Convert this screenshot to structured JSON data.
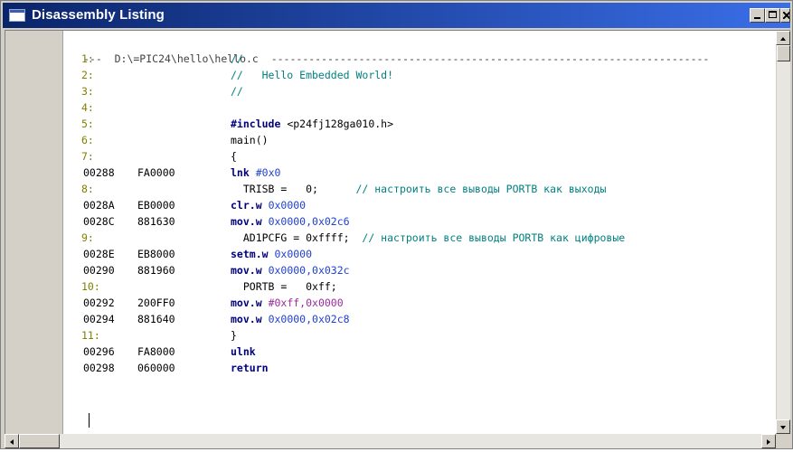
{
  "window": {
    "title": "Disassembly Listing",
    "buttons": {
      "minimize": "minimize",
      "maximize": "maximize",
      "close": "close"
    }
  },
  "listing": {
    "header": "---  D:\\=PIC24\\hello\\hello.c  ----------------------------------------------------------------------",
    "lines": [
      {
        "kind": "src",
        "num": "1:",
        "text": "//",
        "style": "cmt"
      },
      {
        "kind": "src",
        "num": "2:",
        "text": "//   Hello Embedded World!",
        "style": "cmt"
      },
      {
        "kind": "src",
        "num": "3:",
        "text": "//",
        "style": "cmt"
      },
      {
        "kind": "src",
        "num": "4:",
        "text": "",
        "style": "plain"
      },
      {
        "kind": "src",
        "num": "5:",
        "text_kw": "#include",
        "text_rest": " <p24fj128ga010.h>"
      },
      {
        "kind": "src",
        "num": "6:",
        "text": "main()",
        "style": "plain"
      },
      {
        "kind": "src",
        "num": "7:",
        "text": "{",
        "style": "plain"
      },
      {
        "kind": "asm",
        "addr": "00288",
        "hex": "FA0000",
        "mn": "lnk",
        "ops": "#0x0",
        "ops_style": "op"
      },
      {
        "kind": "src",
        "num": "8:",
        "text_code": "  TRISB =   0;",
        "text_cmt": "      // настроить все выводы PORTB как выходы"
      },
      {
        "kind": "asm",
        "addr": "0028A",
        "hex": "EB0000",
        "mn": "clr.w",
        "ops": "0x0000",
        "ops_style": "op"
      },
      {
        "kind": "asm",
        "addr": "0028C",
        "hex": "881630",
        "mn": "mov.w",
        "ops": "0x0000,0x02c6",
        "ops_style": "op"
      },
      {
        "kind": "src",
        "num": "9:",
        "text_code": "  AD1PCFG = 0xffff;",
        "text_cmt": "  // настроить все выводы PORTB как цифровые"
      },
      {
        "kind": "asm",
        "addr": "0028E",
        "hex": "EB8000",
        "mn": "setm.w",
        "ops": "0x0000",
        "ops_style": "op"
      },
      {
        "kind": "asm",
        "addr": "00290",
        "hex": "881960",
        "mn": "mov.w",
        "ops": "0x0000,0x032c",
        "ops_style": "op"
      },
      {
        "kind": "src",
        "num": "10:",
        "text_code": "  PORTB =   0xff;",
        "text_cmt": ""
      },
      {
        "kind": "asm",
        "addr": "00292",
        "hex": "200FF0",
        "mn": "mov.w",
        "ops": "#0xff,0x0000",
        "ops_style": "opm"
      },
      {
        "kind": "asm",
        "addr": "00294",
        "hex": "881640",
        "mn": "mov.w",
        "ops": "0x0000,0x02c8",
        "ops_style": "op"
      },
      {
        "kind": "src",
        "num": "11:",
        "text": "}",
        "style": "plain"
      },
      {
        "kind": "asm",
        "addr": "00296",
        "hex": "FA8000",
        "mn": "ulnk",
        "ops": "",
        "ops_style": "op"
      },
      {
        "kind": "asm",
        "addr": "00298",
        "hex": "060000",
        "mn": "return",
        "ops": "",
        "ops_style": "op"
      }
    ]
  },
  "colors": {
    "title_gradient_start": "#0a246a",
    "title_gradient_end": "#3a6ee8",
    "line_number": "#808000",
    "mnemonic": "#00007f",
    "operand": "#2040d0",
    "comment": "#008080"
  },
  "icons": {
    "window": "listing-window-icon",
    "scroll_up": "scroll-up-arrow-icon",
    "scroll_down": "scroll-down-arrow-icon",
    "scroll_left": "scroll-left-arrow-icon",
    "scroll_right": "scroll-right-arrow-icon"
  }
}
